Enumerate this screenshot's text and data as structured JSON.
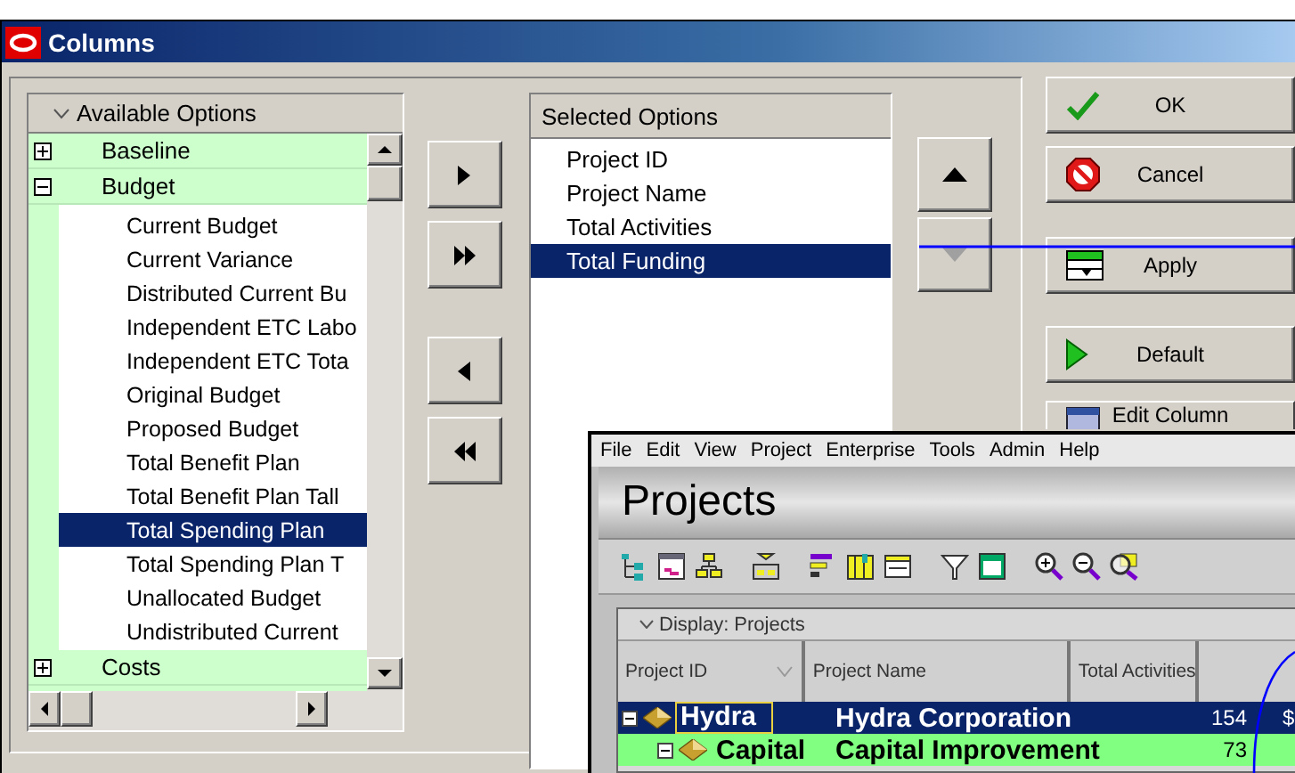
{
  "window": {
    "title": "Columns"
  },
  "available_options": {
    "header": "Available Options",
    "groups": [
      {
        "label": "Baseline",
        "expanded": false
      },
      {
        "label": "Budget",
        "expanded": true,
        "children": [
          {
            "label": "Current Budget",
            "selected": false
          },
          {
            "label": "Current Variance",
            "selected": false
          },
          {
            "label": "Distributed Current Bu",
            "selected": false
          },
          {
            "label": "Independent ETC Labo",
            "selected": false
          },
          {
            "label": "Independent ETC Tota",
            "selected": false
          },
          {
            "label": "Original Budget",
            "selected": false
          },
          {
            "label": "Proposed Budget",
            "selected": false
          },
          {
            "label": "Total Benefit Plan",
            "selected": false
          },
          {
            "label": "Total Benefit Plan Tall",
            "selected": false
          },
          {
            "label": "Total Spending Plan",
            "selected": true
          },
          {
            "label": "Total Spending Plan T",
            "selected": false
          },
          {
            "label": "Unallocated Budget",
            "selected": false
          },
          {
            "label": "Undistributed Current",
            "selected": false
          }
        ]
      },
      {
        "label": "Costs",
        "expanded": false
      }
    ]
  },
  "selected_options": {
    "header": "Selected Options",
    "items": [
      {
        "label": "Project ID",
        "selected": false
      },
      {
        "label": "Project Name",
        "selected": false
      },
      {
        "label": "Total Activities",
        "selected": false
      },
      {
        "label": "Total Funding",
        "selected": true
      }
    ]
  },
  "order_buttons": [
    {
      "kind": "up",
      "disabled": false
    },
    {
      "kind": "down",
      "disabled": true
    }
  ],
  "actions": [
    {
      "kind": "ok",
      "label": "OK"
    },
    {
      "kind": "cancel",
      "label": "Cancel"
    },
    {
      "kind": "apply",
      "label": "Apply"
    },
    {
      "kind": "default",
      "label": "Default"
    },
    {
      "kind": "edit",
      "label": "Edit Column"
    }
  ],
  "app_window": {
    "menu": [
      "File",
      "Edit",
      "View",
      "Project",
      "Enterprise",
      "Tools",
      "Admin",
      "Help"
    ],
    "title": "Projects",
    "display_label": "Display: Projects",
    "columns": [
      "Project ID",
      "Project Name",
      "Total Activities"
    ],
    "rows": [
      {
        "id": "Hydra",
        "name": "Hydra Corporation",
        "total_activities": "154",
        "column_4": "$",
        "selected": true,
        "expanded": true
      },
      {
        "id": "Capital",
        "name": "Capital Improvement",
        "total_activities": "73",
        "selected": false,
        "expanded": true,
        "color": "#80ff80"
      }
    ]
  }
}
